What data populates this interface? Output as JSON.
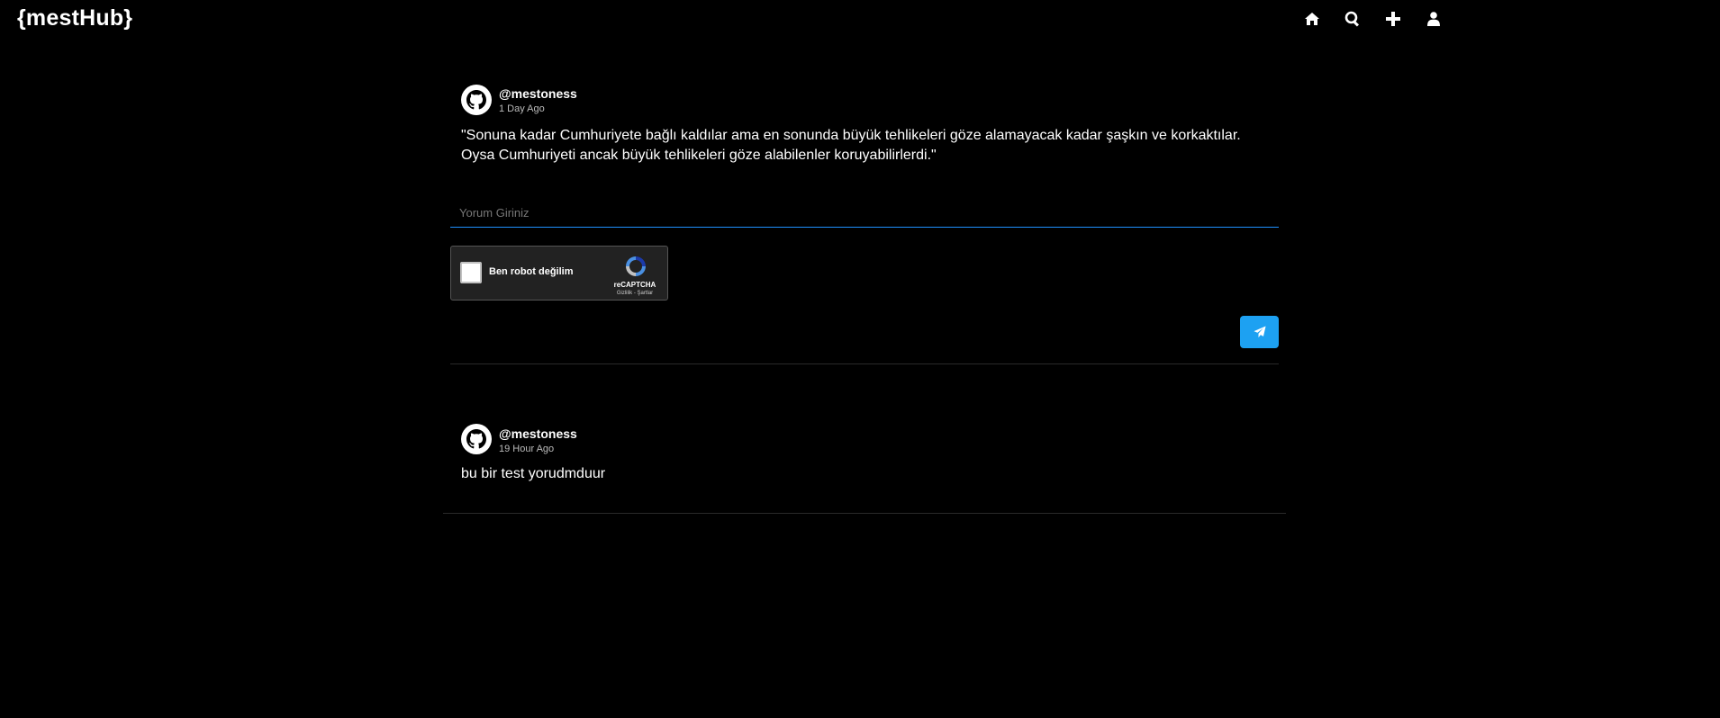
{
  "header": {
    "logo": "{mestHub}",
    "nav": [
      {
        "name": "home-icon"
      },
      {
        "name": "search-icon"
      },
      {
        "name": "plus-icon"
      },
      {
        "name": "user-icon"
      }
    ]
  },
  "post": {
    "username": "@mestoness",
    "time": "1 Day Ago",
    "text": "\"Sonuna kadar Cumhuriyete bağlı kaldılar ama en sonunda büyük tehlikeleri göze alamayacak kadar şaşkın ve korkaktılar. Oysa Cumhuriyeti ancak büyük tehlikeleri göze alabilenler koruyabilirlerdi.\"",
    "avatar_icon": "github-icon"
  },
  "comment_form": {
    "placeholder": "Yorum Giriniz",
    "recaptcha_label": "Ben robot değilim",
    "recaptcha_brand": "reCAPTCHA",
    "recaptcha_links": "Gizlilik - Şartlar",
    "send_icon": "paper-plane-icon"
  },
  "comments": [
    {
      "username": "@mestoness",
      "time": "19 Hour Ago",
      "text": "bu bir test yorudmduur",
      "avatar_icon": "github-icon"
    }
  ],
  "colors": {
    "background": "#000000",
    "accent": "#1da1f2",
    "input_underline": "#1e90ff",
    "divider": "#2a2a2a"
  }
}
